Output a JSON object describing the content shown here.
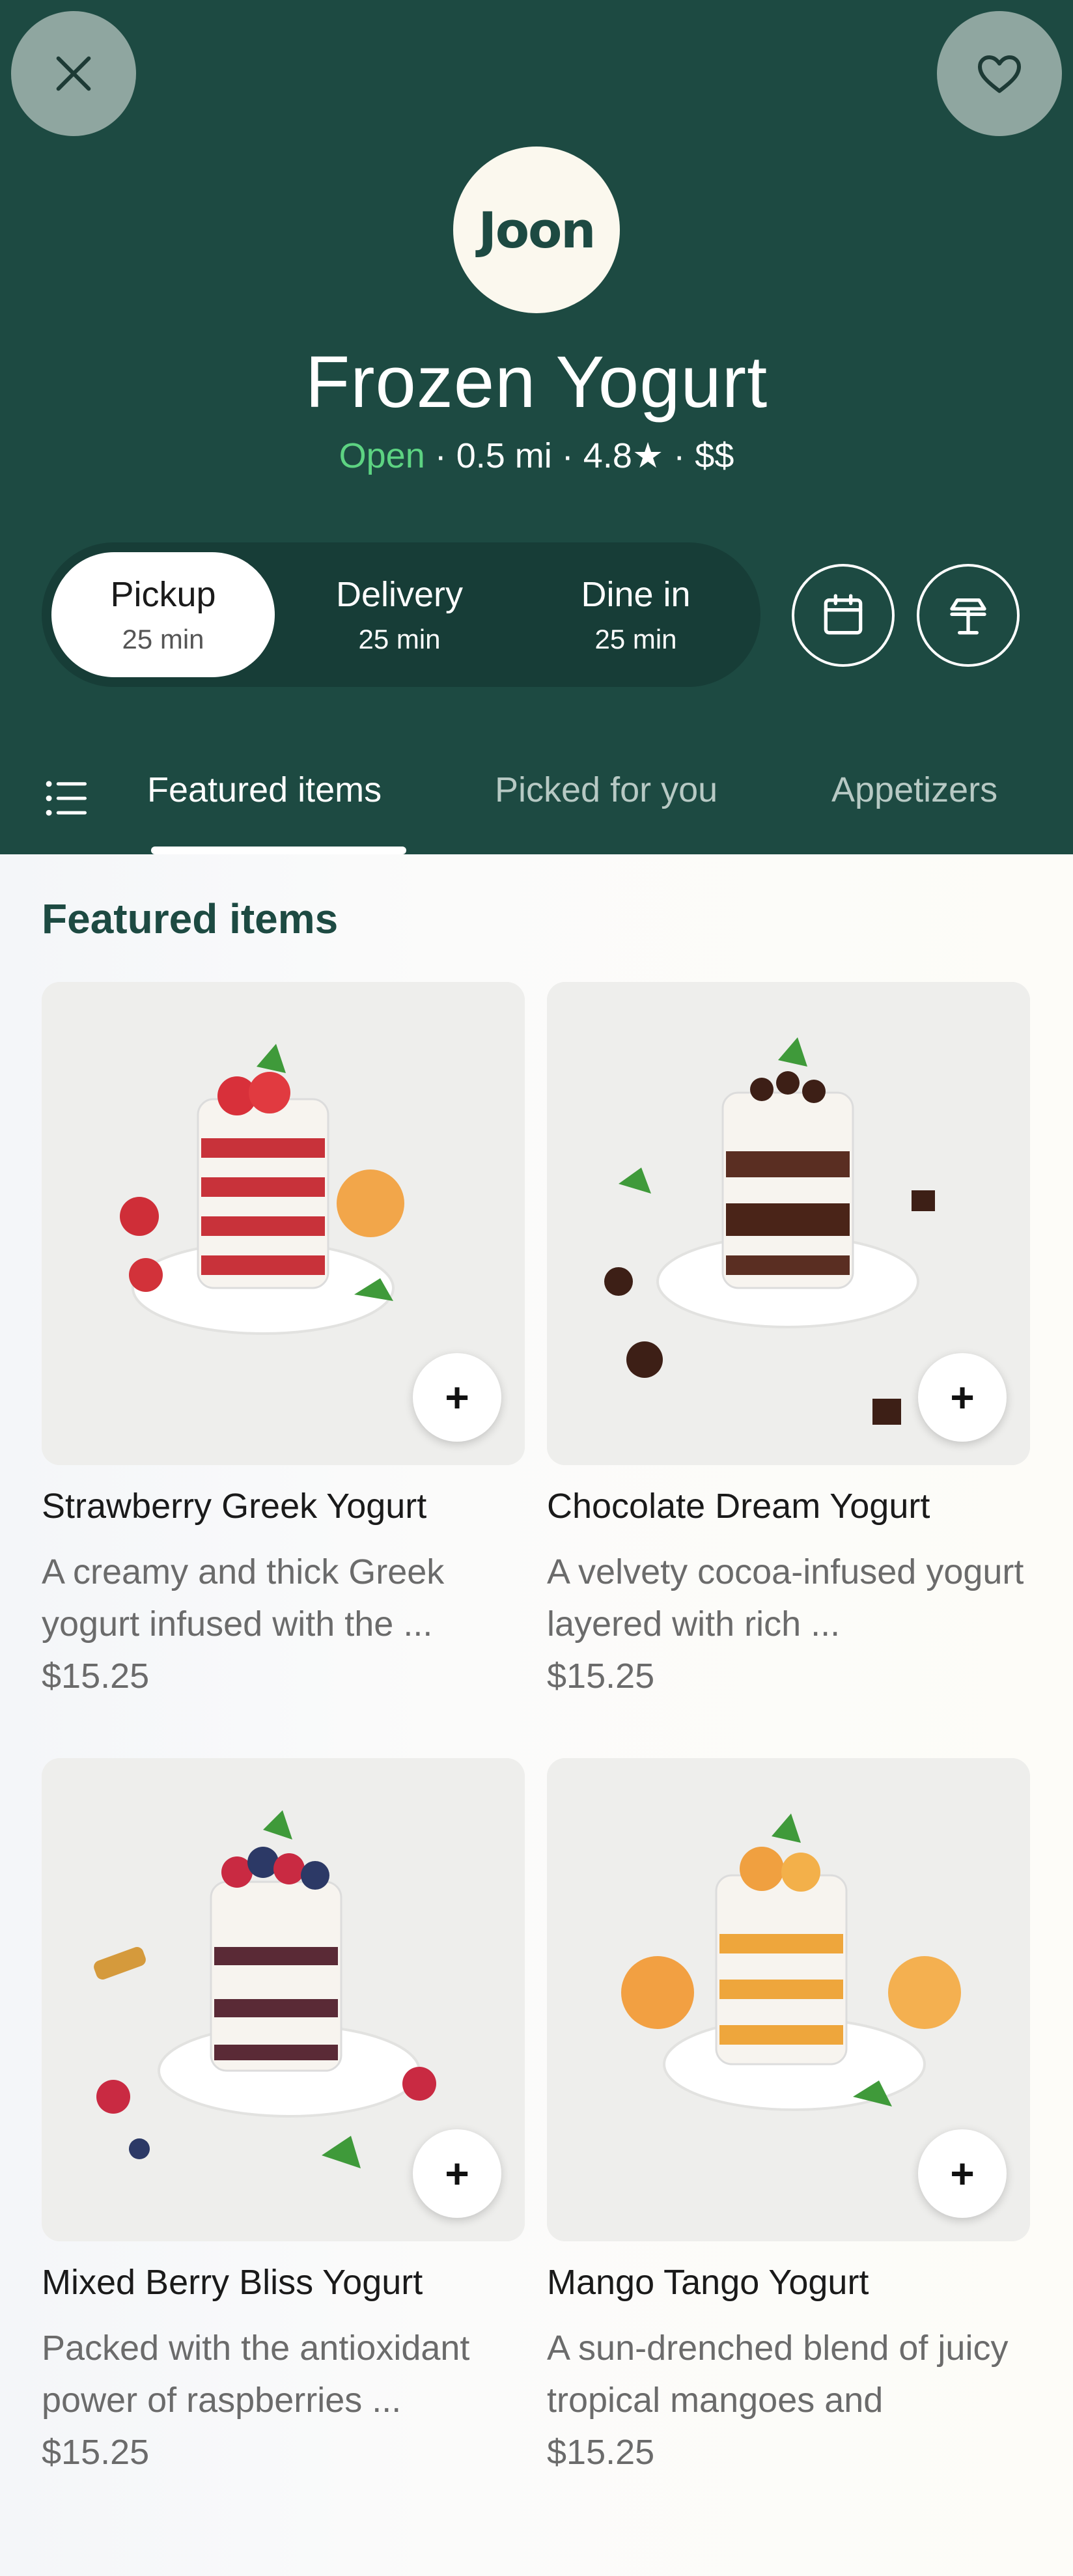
{
  "header": {
    "logo_text": "Joon",
    "title": "Frozen Yogurt",
    "status": "Open",
    "distance": "0.5 mi",
    "rating": "4.8★",
    "price_level": "$$",
    "separator": " · "
  },
  "modes": [
    {
      "label": "Pickup",
      "time": "25 min",
      "active": true
    },
    {
      "label": "Delivery",
      "time": "25 min",
      "active": false
    },
    {
      "label": "Dine in",
      "time": "25 min",
      "active": false
    }
  ],
  "tabs": [
    {
      "label": "Featured items",
      "active": true
    },
    {
      "label": "Picked for you",
      "active": false
    },
    {
      "label": "Appetizers",
      "active": false
    }
  ],
  "section": {
    "title": "Featured items"
  },
  "items": [
    {
      "name": "Strawberry Greek Yogurt",
      "desc": "A creamy and thick Greek yogurt infused with the ...",
      "price": "$15.25",
      "add": "+"
    },
    {
      "name": "Chocolate Dream Yogurt",
      "desc": "A velvety cocoa-infused yogurt layered with rich ...",
      "price": "$15.25",
      "add": "+"
    },
    {
      "name": "Mixed Berry Bliss Yogurt",
      "desc": "Packed with the antioxidant power of raspberries ...",
      "price": "$15.25",
      "add": "+"
    },
    {
      "name": "Mango Tango Yogurt",
      "desc": "A sun-drenched blend of juicy tropical mangoes and",
      "price": "$15.25",
      "add": "+"
    }
  ],
  "colors": {
    "header_bg": "#1d4a42",
    "open_green": "#5dd382",
    "section_title": "#1d4a42"
  },
  "icons": [
    "close-icon",
    "heart-icon",
    "calendar-icon",
    "table-lamp-icon",
    "menu-list-icon",
    "plus-icon"
  ]
}
